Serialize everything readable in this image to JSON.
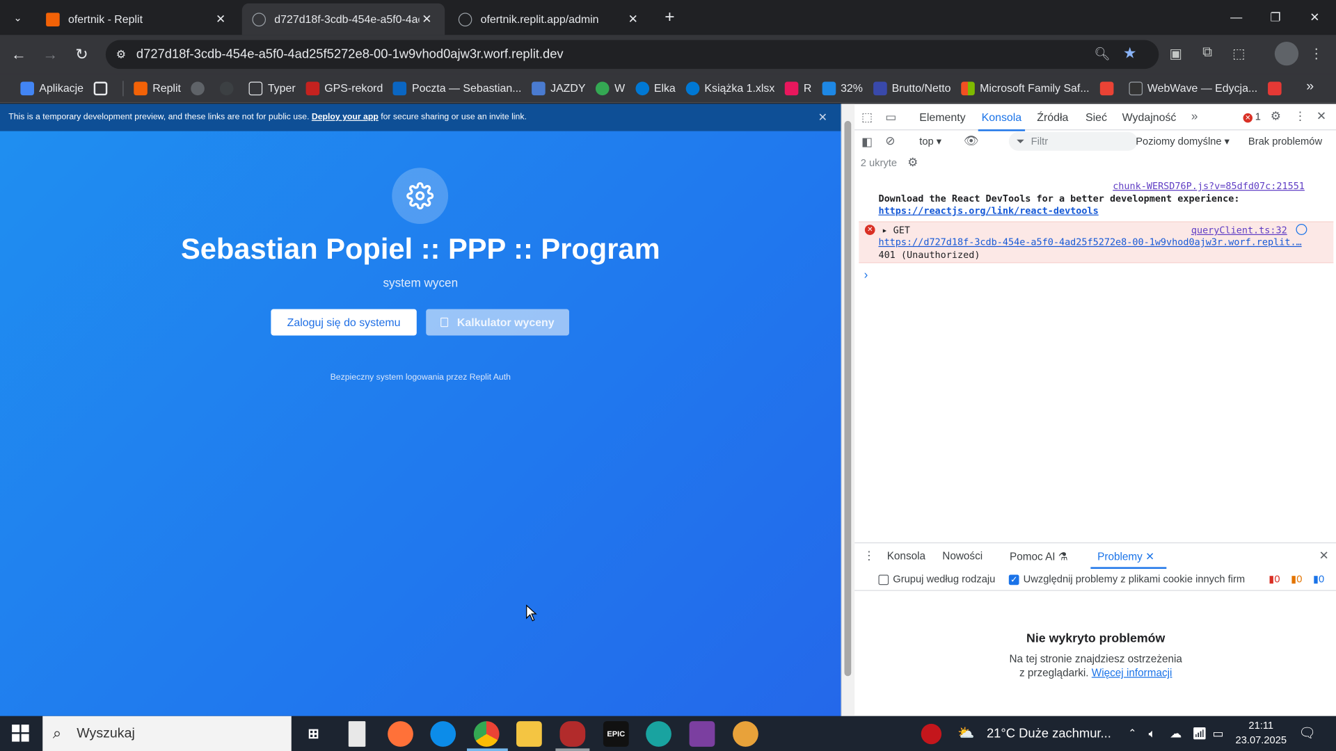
{
  "browser": {
    "tabs": [
      {
        "title": "ofertnik - Replit",
        "active": false
      },
      {
        "title": "d727d18f-3cdb-454e-a5f0-4ad",
        "active": true
      },
      {
        "title": "ofertnik.replit.app/admin",
        "active": false
      }
    ],
    "url": "d727d18f-3cdb-454e-a5f0-4ad25f5272e8-00-1w9vhod0ajw3r.worf.replit.dev",
    "bookmarks": [
      {
        "label": "Aplikacje",
        "icon": "apps-grid-icon",
        "color": "#4285f4"
      },
      {
        "label": "Replit",
        "icon": "replit-icon",
        "color": "#f26207"
      },
      {
        "label": "Typer",
        "icon": "folder-icon",
        "color": "#5f6368"
      },
      {
        "label": "GPS-rekord",
        "icon": "gps-icon",
        "color": "#c5221f"
      },
      {
        "label": "Poczta — Sebastian...",
        "icon": "mail-icon",
        "color": "#0a66c2"
      },
      {
        "label": "JAZDY",
        "icon": "calendar-icon",
        "color": "#4a7bd0"
      },
      {
        "label": "W",
        "icon": "chrome-icon",
        "color": "#34a853"
      },
      {
        "label": "Elka",
        "icon": "onedrive-icon",
        "color": "#0078d4"
      },
      {
        "label": "Książka 1.xlsx",
        "icon": "onedrive-icon",
        "color": "#0078d4"
      },
      {
        "label": "R",
        "icon": "r-icon",
        "color": "#e8175d"
      },
      {
        "label": "32%",
        "icon": "bulb-icon",
        "color": "#1e88e5"
      },
      {
        "label": "Brutto/Netto",
        "icon": "p-icon",
        "color": "#3949ab"
      },
      {
        "label": "Microsoft Family Saf...",
        "icon": "microsoft-icon",
        "color": "#f25022"
      },
      {
        "label": "",
        "icon": "gmail-icon",
        "color": "#ea4335"
      },
      {
        "label": "WebWave — Edycja...",
        "icon": "webwave-icon",
        "color": "#333333"
      }
    ]
  },
  "page": {
    "banner_text": "This is a temporary development preview, and these links are not for public use. ",
    "banner_link": "Deploy your app",
    "banner_tail": " for secure sharing or use an invite link.",
    "title": "Sebastian Popiel :: PPP :: Program",
    "subtitle": "system wycen",
    "login_button": "Zaloguj się do systemu",
    "calc_button": "Kalkulator wyceny",
    "secure_note": "Bezpieczny system logowania przez Replit Auth"
  },
  "devtools": {
    "tabs": [
      "Elementy",
      "Konsola",
      "Źródła",
      "Sieć",
      "Wydajność"
    ],
    "active_tab": "Konsola",
    "error_count": "1",
    "context": "top",
    "filter_placeholder": "Filtr",
    "levels": "Poziomy domyślne",
    "issues": "Brak problemów",
    "hidden": "2 ukryte",
    "console": {
      "msg1_source": "chunk-WERSD76P.js?v=85dfd07c:21551",
      "msg1_text": "Download the React DevTools for a better development experience:",
      "msg1_link": "https://reactjs.org/link/react-devtools",
      "err_method": "GET",
      "err_source": "queryClient.ts:32",
      "err_url": "https://d727d18f-3cdb-454e-a5f0-4ad25f5272e8-00-1w9vhod0ajw3r.worf.replit.…",
      "err_status": "401 (Unauthorized)"
    },
    "drawer": {
      "tabs": [
        "Konsola",
        "Nowości",
        "Pomoc AI",
        "Problemy"
      ],
      "active_tab": "Problemy",
      "group_label": "Grupuj według rodzaju",
      "cookie_label": "Uwzględnij problemy z plikami cookie innych firm",
      "count_errors": "0",
      "count_warnings": "0",
      "count_info": "0",
      "empty_title": "Nie wykryto problemów",
      "empty_line1": "Na tej stronie znajdziesz ostrzeżenia",
      "empty_line2": "z przeglądarki.",
      "empty_link": "Więcej informacji"
    }
  },
  "taskbar": {
    "search_placeholder": "Wyszukaj",
    "weather": "21°C  Duże zachmur...",
    "time": "21:11",
    "date": "23.07.2025"
  }
}
